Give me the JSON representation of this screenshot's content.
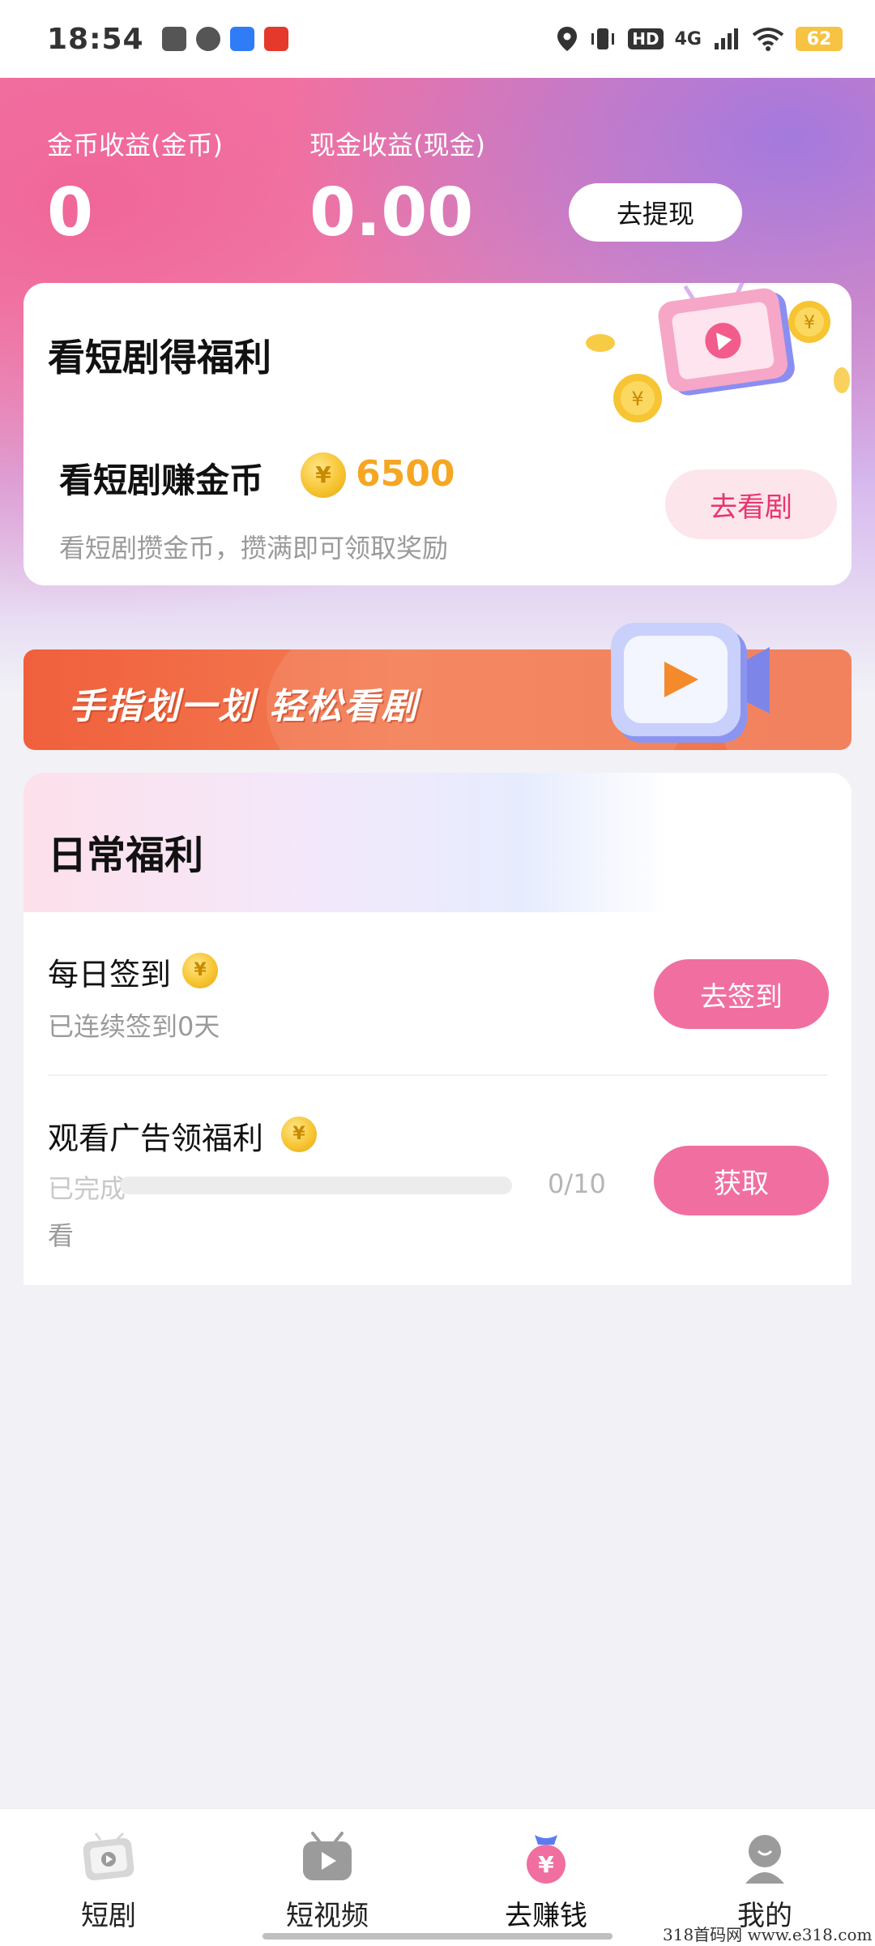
{
  "status_bar": {
    "time": "18:54",
    "network": "4G",
    "battery": "62",
    "hd": "HD"
  },
  "earnings": {
    "coin_label": "金币收益(金币)",
    "coin_value": "0",
    "cash_label": "现金收益(现金)",
    "cash_value": "0.00",
    "withdraw_label": "去提现"
  },
  "drama_card": {
    "title": "看短剧得福利",
    "task_title": "看短剧赚金币",
    "task_coins": "6500",
    "task_desc": "看短剧攒金币，攒满即可领取奖励",
    "button_label": "去看剧",
    "coin_symbol": "¥"
  },
  "banner": {
    "text": "手指划一划 轻松看剧"
  },
  "daily": {
    "title": "日常福利",
    "tasks": [
      {
        "title": "每日签到",
        "sub": "已连续签到0天",
        "button_label": "去签到"
      },
      {
        "title": "观看广告领福利",
        "sub_prefix": "已完成",
        "sub_suffix": "看",
        "progress_text": "0/10",
        "progress": 0,
        "button_label": "获取"
      }
    ]
  },
  "bottom_nav": {
    "items": [
      {
        "label": "短剧",
        "icon": "drama-tv-icon"
      },
      {
        "label": "短视频",
        "icon": "short-video-icon"
      },
      {
        "label": "去赚钱",
        "icon": "money-bag-icon",
        "active": true
      },
      {
        "label": "我的",
        "icon": "profile-icon"
      }
    ]
  },
  "watermark": "318首码网 www.e318.com",
  "colors": {
    "accent_pink": "#f06fa0",
    "coin_gold": "#f5a623",
    "button_text_pink": "#e6356f"
  }
}
